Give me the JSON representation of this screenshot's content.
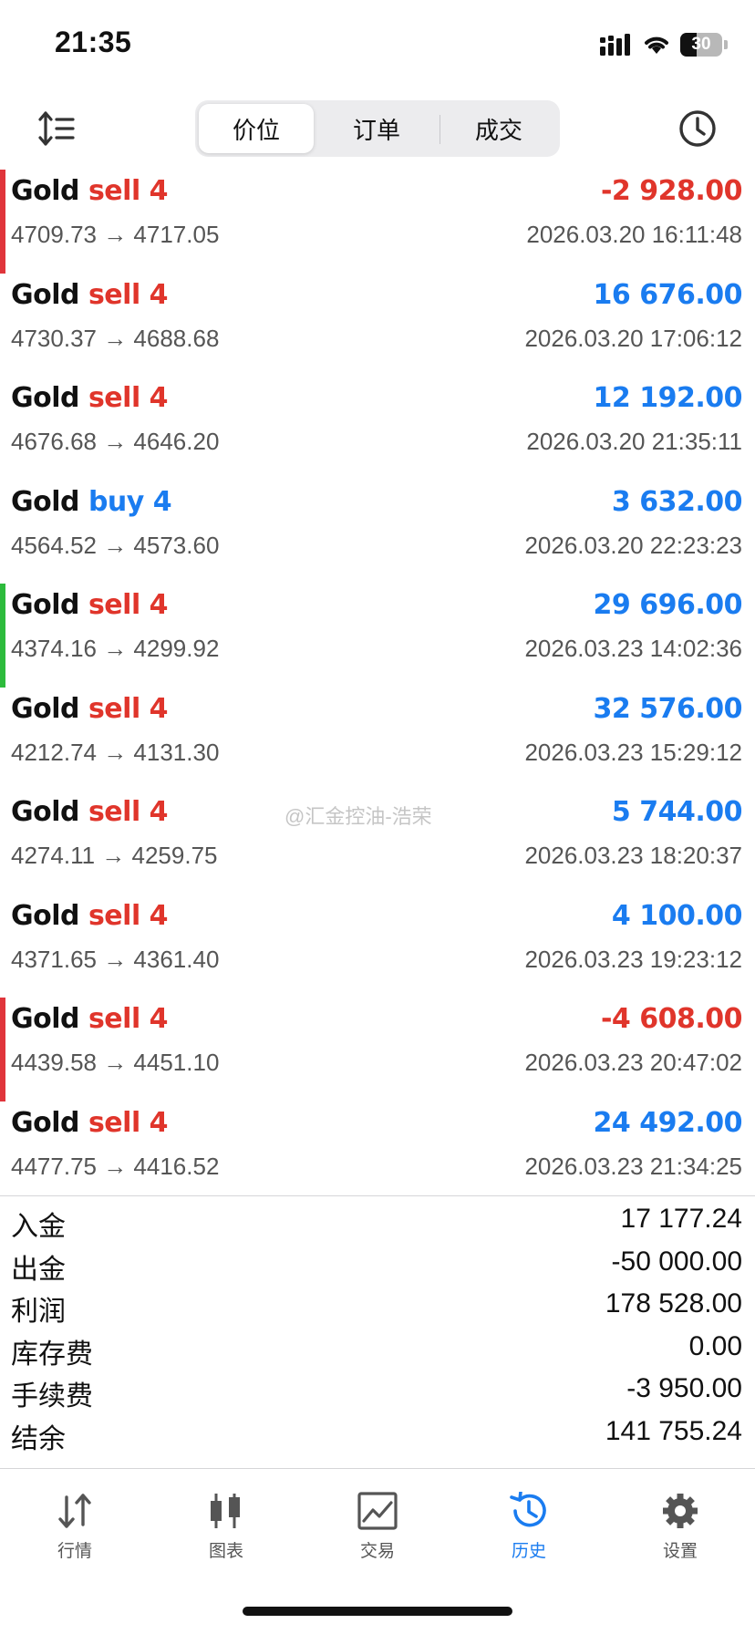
{
  "status_bar": {
    "time": "21:35",
    "battery": "30"
  },
  "tabs_top": [
    {
      "label": "价位",
      "active": true
    },
    {
      "label": "订单",
      "active": false
    },
    {
      "label": "成交",
      "active": false
    }
  ],
  "trades": [
    {
      "symbol": "Gold",
      "side": "sell 4",
      "direction": "sell",
      "prices": "4709.73 → 4717.05",
      "profit": "-2 928.00",
      "sign": "neg",
      "time": "2026.03.20 16:11:48",
      "bar": "#e0353b"
    },
    {
      "symbol": "Gold",
      "side": "sell 4",
      "direction": "sell",
      "prices": "4730.37 → 4688.68",
      "profit": "16 676.00",
      "sign": "pos",
      "time": "2026.03.20 17:06:12",
      "bar": ""
    },
    {
      "symbol": "Gold",
      "side": "sell 4",
      "direction": "sell",
      "prices": "4676.68 → 4646.20",
      "profit": "12 192.00",
      "sign": "pos",
      "time": "2026.03.20 21:35:11",
      "bar": ""
    },
    {
      "symbol": "Gold",
      "side": "buy 4",
      "direction": "buy",
      "prices": "4564.52 → 4573.60",
      "profit": "3 632.00",
      "sign": "pos",
      "time": "2026.03.20 22:23:23",
      "bar": ""
    },
    {
      "symbol": "Gold",
      "side": "sell 4",
      "direction": "sell",
      "prices": "4374.16 → 4299.92",
      "profit": "29 696.00",
      "sign": "pos",
      "time": "2026.03.23 14:02:36",
      "bar": "#2dbb3c"
    },
    {
      "symbol": "Gold",
      "side": "sell 4",
      "direction": "sell",
      "prices": "4212.74 → 4131.30",
      "profit": "32 576.00",
      "sign": "pos",
      "time": "2026.03.23 15:29:12",
      "bar": ""
    },
    {
      "symbol": "Gold",
      "side": "sell 4",
      "direction": "sell",
      "prices": "4274.11 → 4259.75",
      "profit": "5 744.00",
      "sign": "pos",
      "time": "2026.03.23 18:20:37",
      "bar": ""
    },
    {
      "symbol": "Gold",
      "side": "sell 4",
      "direction": "sell",
      "prices": "4371.65 → 4361.40",
      "profit": "4 100.00",
      "sign": "pos",
      "time": "2026.03.23 19:23:12",
      "bar": ""
    },
    {
      "symbol": "Gold",
      "side": "sell 4",
      "direction": "sell",
      "prices": "4439.58 → 4451.10",
      "profit": "-4 608.00",
      "sign": "neg",
      "time": "2026.03.23 20:47:02",
      "bar": "#e0353b"
    },
    {
      "symbol": "Gold",
      "side": "sell 4",
      "direction": "sell",
      "prices": "4477.75 → 4416.52",
      "profit": "24 492.00",
      "sign": "pos",
      "time": "2026.03.23 21:34:25",
      "bar": ""
    }
  ],
  "watermark": "@汇金控油-浩荣",
  "summary": [
    {
      "label": "入金",
      "value": "17 177.24"
    },
    {
      "label": "出金",
      "value": "-50 000.00"
    },
    {
      "label": "利润",
      "value": "178 528.00"
    },
    {
      "label": "库存费",
      "value": "0.00"
    },
    {
      "label": "手续费",
      "value": "-3 950.00"
    },
    {
      "label": "结余",
      "value": "141 755.24"
    }
  ],
  "tab_bar": [
    {
      "label": "行情",
      "icon": "quotes-arrows-icon",
      "active": false
    },
    {
      "label": "图表",
      "icon": "chart-candles-icon",
      "active": false
    },
    {
      "label": "交易",
      "icon": "trade-chart-icon",
      "active": false
    },
    {
      "label": "历史",
      "icon": "history-clock-icon",
      "active": true
    },
    {
      "label": "设置",
      "icon": "gear-icon",
      "active": false
    }
  ],
  "colors": {
    "sell": "#e0352b",
    "buy": "#1a7cf0",
    "profit_pos": "#1a7cf0",
    "profit_neg": "#e0352b",
    "accent": "#1a7cf0"
  }
}
